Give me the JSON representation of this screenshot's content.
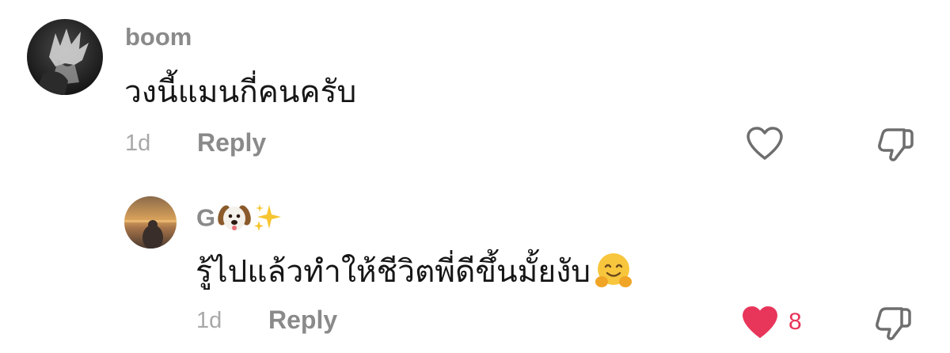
{
  "comments": [
    {
      "username": "boom",
      "text": "วงนี้แมนกี่คนครับ",
      "time": "1d",
      "reply_label": "Reply",
      "liked": false
    },
    {
      "username": "G",
      "username_emojis": [
        "dog-face-emoji",
        "sparkles-emoji"
      ],
      "text": "รู้ไปแล้วทำให้ชีวิตพี่ดีขึ้นมั้ยงับ",
      "text_emoji": "hugging-face-emoji",
      "time": "1d",
      "reply_label": "Reply",
      "liked": true,
      "like_count": "8"
    }
  ],
  "colors": {
    "username": "#8a8a8a",
    "text": "#161616",
    "meta": "#a8a8a8",
    "like_active": "#e8355a",
    "icon_outline": "#6e6e6e"
  },
  "icons": [
    "heart-icon",
    "dislike-icon"
  ]
}
